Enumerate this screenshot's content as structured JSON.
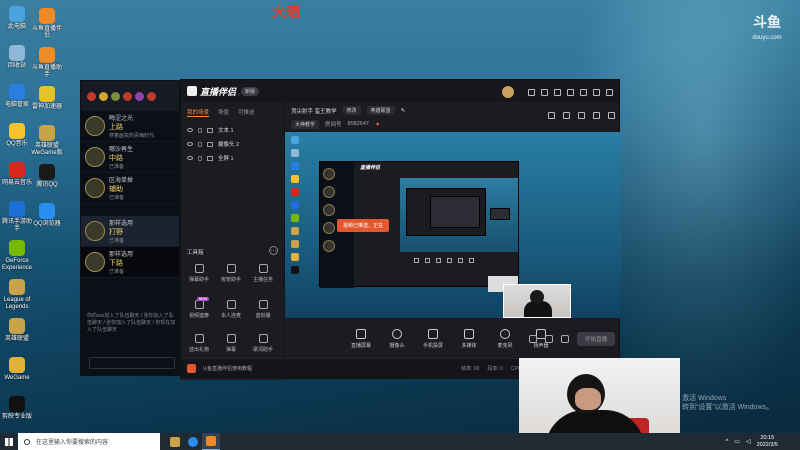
{
  "watermark": "大晒",
  "corner_logo": {
    "main": "斗鱼",
    "sub": "douyu.com"
  },
  "desktop_icons": [
    {
      "label": "此电脑",
      "color": "#4aa3df"
    },
    {
      "label": "回收站",
      "color": "#8fb8d8"
    },
    {
      "label": "电脑管家",
      "color": "#2a7de1"
    },
    {
      "label": "QQ音乐",
      "color": "#f6c32a"
    },
    {
      "label": "网易云音乐",
      "color": "#d9261c"
    },
    {
      "label": "腾讯手游助手",
      "color": "#1e6fd9"
    },
    {
      "label": "GeForce Experience",
      "color": "#76b900"
    },
    {
      "label": "League of Legends",
      "color": "#c9a24a"
    },
    {
      "label": "英雄联盟",
      "color": "#c9a24a"
    },
    {
      "label": "WeGame",
      "color": "#e3b13a"
    },
    {
      "label": "剪映专业版",
      "color": "#111111"
    }
  ],
  "desktop_icons_col2": [
    {
      "label": "斗鱼直播伴侣",
      "color": "#f08a24"
    },
    {
      "label": "斗鱼直播助手",
      "color": "#f08a24"
    },
    {
      "label": "雷神加速器",
      "color": "#e8c22a"
    },
    {
      "label": "英雄联盟 WeGame版",
      "color": "#c9a24a"
    },
    {
      "label": "腾讯QQ",
      "color": "#1a1a1a"
    },
    {
      "label": "QQ浏览器",
      "color": "#2a8ef0"
    }
  ],
  "game_panel": {
    "rows": [
      {
        "t1": "晦涩之光",
        "t2": "上路",
        "t3": "穿着画妆的青晦时代"
      },
      {
        "t1": "哪沙再生",
        "t2": "中路",
        "t3": "已准备"
      },
      {
        "t1": "区海单掉",
        "t2": "辅助",
        "t3": "已准备"
      },
      {
        "t1": "那样选用",
        "t2": "打野",
        "t3": "已准备"
      },
      {
        "t1": "那样选用",
        "t2": "下路",
        "t3": "已准备"
      }
    ],
    "chat": "你的sss加入了队伍聊天 / 张你加入了队伍聊天 / 张你加入了队伍聊天 / 你现在加入了队伍聊天"
  },
  "stream_window": {
    "logo": "直播伴侣",
    "version": "新版",
    "tabs": [
      "我的场景",
      "场景",
      "可推送"
    ],
    "scenes": [
      "文本 1",
      "摄像头 2",
      "全屏 1"
    ],
    "tools_title": "工具箱",
    "tools": [
      {
        "label": "弹幕助手"
      },
      {
        "label": "房管助手"
      },
      {
        "label": "主播任务"
      },
      {
        "label": "視頻連麥",
        "badge": "NEW"
      },
      {
        "label": "本人连麦"
      },
      {
        "label": "虚拟播"
      },
      {
        "label": "选出礼物"
      },
      {
        "label": "弹幕"
      },
      {
        "label": "歌词助手"
      }
    ],
    "room": {
      "title": "顶尖射手 蛮王教学",
      "tag": "修改",
      "game": "英雄联盟",
      "category": "大神教学",
      "uid_label": "房间号",
      "uid": "8582647"
    },
    "toast": "视频已推送，正在",
    "controls": [
      "直播屏幕",
      "摄像头",
      "手机投屏",
      "多媒体",
      "麦克风",
      "扬声器"
    ],
    "go_live": "开始直播",
    "footer_text": "斗鱼直播伴侣使用教程",
    "stats": [
      "帧率: 60",
      "码率: 0",
      "CPU: 9%"
    ]
  },
  "activate_windows": [
    "激活 Windows",
    "转到“设置”以激活 Windows。"
  ],
  "taskbar": {
    "search_placeholder": "在这里输入你要搜索的内容",
    "time": "20:15",
    "date": "2022/3/5"
  }
}
